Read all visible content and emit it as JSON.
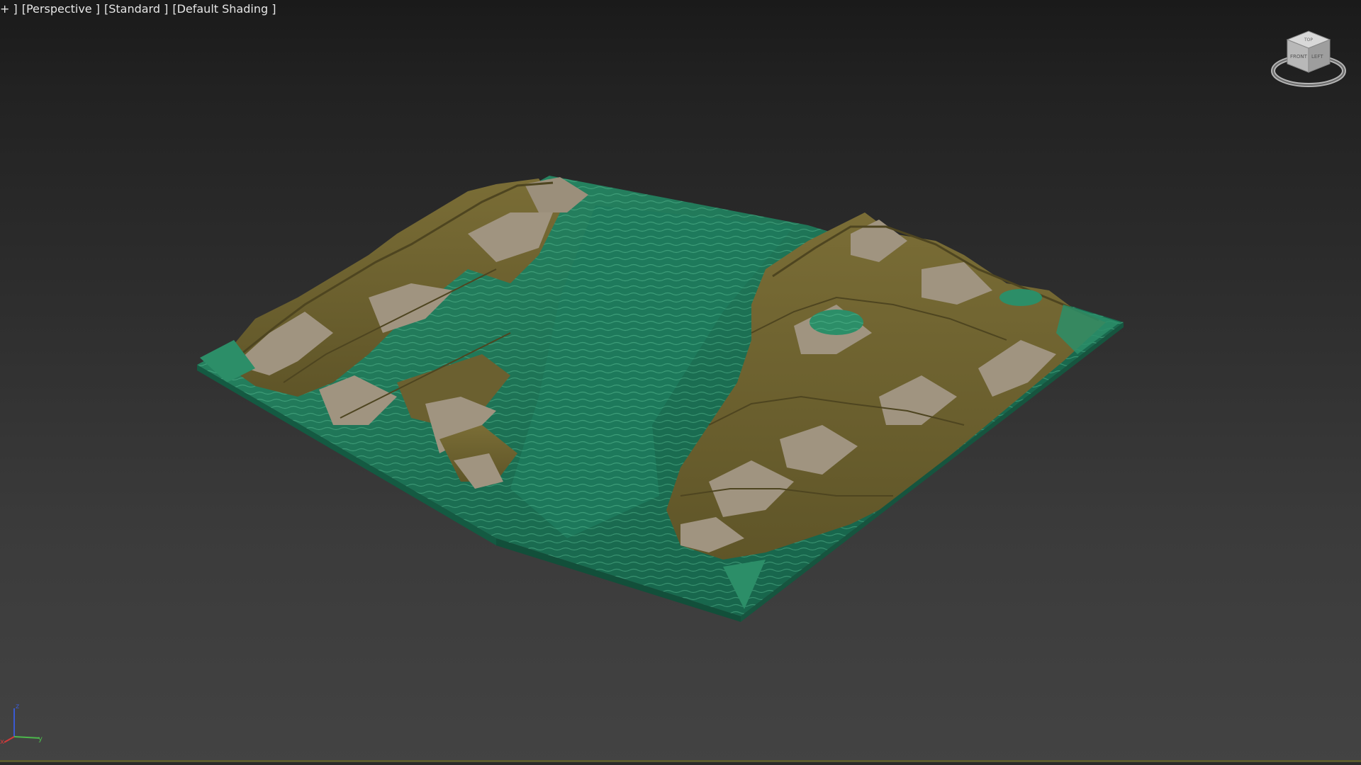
{
  "viewport": {
    "labels": {
      "menu": "+ ]",
      "view": "[Perspective ]",
      "preset": "[Standard ]",
      "shading": "[Default Shading ]"
    },
    "viewcube": {
      "face_labels": [
        "FRONT",
        "LEFT",
        "TOP"
      ],
      "icon": "viewcube-icon"
    },
    "axis_tripod": {
      "axes": [
        "z",
        "x",
        "y"
      ],
      "colors": {
        "x": "#d23a3a",
        "y": "#4cb84c",
        "z": "#3a5ad2"
      }
    }
  },
  "scene": {
    "object": "terrain-mesh",
    "colors": {
      "rock": "#6e6330",
      "rock_light": "#8b7f45",
      "sand": "#9a8f7d",
      "water": "#1f7a5a",
      "water_light": "#3aa27a"
    }
  }
}
